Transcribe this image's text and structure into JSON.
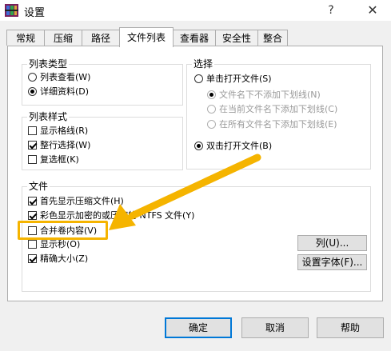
{
  "window": {
    "title": "设置",
    "help": "?",
    "close": "✕"
  },
  "tabs": [
    {
      "label": "常规"
    },
    {
      "label": "压缩"
    },
    {
      "label": "路径"
    },
    {
      "label": "文件列表"
    },
    {
      "label": "查看器"
    },
    {
      "label": "安全性"
    },
    {
      "label": "整合"
    }
  ],
  "list_type": {
    "title": "列表类型",
    "options": [
      {
        "label": "列表查看(W)",
        "checked": false
      },
      {
        "label": "详细资料(D)",
        "checked": true
      }
    ]
  },
  "select": {
    "title": "选择",
    "single_click": "单击打开文件(S)",
    "sub_options": [
      {
        "label": "文件名下不添加下划线(N)",
        "checked": true
      },
      {
        "label": "在当前文件名下添加下划线(C)",
        "checked": false
      },
      {
        "label": "在所有文件名下添加下划线(E)",
        "checked": false
      }
    ],
    "double_click": "双击打开文件(B)"
  },
  "list_style": {
    "title": "列表样式",
    "options": [
      {
        "label": "显示格线(R)",
        "checked": false
      },
      {
        "label": "整行选择(W)",
        "checked": true
      },
      {
        "label": "复选框(K)",
        "checked": false
      }
    ]
  },
  "files": {
    "title": "文件",
    "options": [
      {
        "label": "首先显示压缩文件(H)",
        "checked": true
      },
      {
        "label": "彩色显示加密的或压缩的 NTFS 文件(Y)",
        "checked": true
      },
      {
        "label": "合并卷内容(V)",
        "checked": false
      },
      {
        "label": "显示秒(O)",
        "checked": false
      },
      {
        "label": "精确大小(Z)",
        "checked": true
      }
    ],
    "columns_button": "列(U)...",
    "font_button": "设置字体(F)..."
  },
  "buttons": {
    "ok": "确定",
    "cancel": "取消",
    "help": "帮助"
  },
  "colors": {
    "highlight": "#f5b400",
    "focus": "#0078d7"
  }
}
